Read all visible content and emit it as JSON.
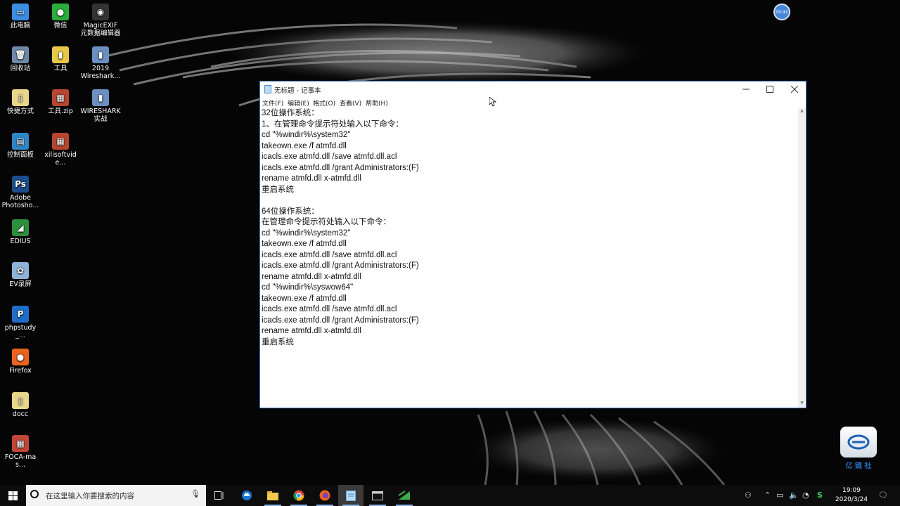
{
  "desktop": {
    "icons": [
      {
        "label": "此电脑",
        "glyph": "▭",
        "color": "#3b8de0"
      },
      {
        "label": "回收站",
        "glyph": "🗑",
        "color": "#6f8aa8"
      },
      {
        "label": "快捷方式",
        "glyph": "▯",
        "color": "#e8d68a"
      },
      {
        "label": "控制面板",
        "glyph": "▤",
        "color": "#2f86c7"
      },
      {
        "label": "Adobe\nPhotosho...",
        "glyph": "Ps",
        "color": "#1b4e8f"
      },
      {
        "label": "EDIUS",
        "glyph": "◢",
        "color": "#2d8f3b"
      },
      {
        "label": "EV录屏",
        "glyph": "✿",
        "color": "#8fb3d8"
      },
      {
        "label": "phpstudy_...",
        "glyph": "P",
        "color": "#1e6ec8"
      },
      {
        "label": "Firefox",
        "glyph": "●",
        "color": "#e8641e"
      },
      {
        "label": "docc",
        "glyph": "▯",
        "color": "#e8d68a"
      },
      {
        "label": "FOCA-mas...",
        "glyph": "▦",
        "color": "#c0463a"
      },
      {
        "label": "微信",
        "glyph": "●",
        "color": "#2aae3b"
      },
      {
        "label": "工具",
        "glyph": "▮",
        "color": "#e8c84a"
      },
      {
        "label": "工具.zip",
        "glyph": "▦",
        "color": "#b6462f"
      },
      {
        "label": "xilisoftvide...",
        "glyph": "▦",
        "color": "#b6462f"
      },
      {
        "label": "MagicEXIF\n元数据编辑器",
        "glyph": "◉",
        "color": "#333333"
      },
      {
        "label": "2019\nWireshark...",
        "glyph": "▮",
        "color": "#6a8fc0"
      },
      {
        "label": "WIRESHARK\n实战",
        "glyph": "▮",
        "color": "#6a8fc0"
      }
    ],
    "badge_text": "00:41",
    "watermark_text": "亿 链 社"
  },
  "notepad": {
    "title": "无标题 - 记事本",
    "menu": [
      "文件(F)",
      "编辑(E)",
      "格式(O)",
      "查看(V)",
      "帮助(H)"
    ],
    "lines": [
      "32位操作系统：",
      "1、在管理命令提示符处输入以下命令：",
      "cd \"%windir%\\system32\"",
      "takeown.exe /f atmfd.dll",
      "icacls.exe atmfd.dll /save atmfd.dll.acl",
      "icacls.exe atmfd.dll /grant Administrators:(F)",
      "rename atmfd.dll x-atmfd.dll",
      "重启系统",
      "",
      "64位操作系统：",
      "在管理命令提示符处输入以下命令：",
      "cd \"%windir%\\system32\"",
      "takeown.exe /f atmfd.dll",
      "icacls.exe atmfd.dll /save atmfd.dll.acl",
      "icacls.exe atmfd.dll /grant Administrators:(F)",
      "rename atmfd.dll x-atmfd.dll",
      "cd \"%windir%\\syswow64\"",
      "takeown.exe /f atmfd.dll",
      "icacls.exe atmfd.dll /save atmfd.dll.acl",
      "icacls.exe atmfd.dll /grant Administrators:(F)",
      "rename atmfd.dll x-atmfd.dll",
      "重启系统"
    ]
  },
  "taskbar": {
    "search_placeholder": "在这里输入你要搜索的内容",
    "apps": [
      "task-view",
      "edge",
      "file-explorer",
      "chrome",
      "firefox",
      "notepad",
      "terminal",
      "edius"
    ],
    "clock_time": "19:09",
    "clock_date": "2020/3/24"
  }
}
